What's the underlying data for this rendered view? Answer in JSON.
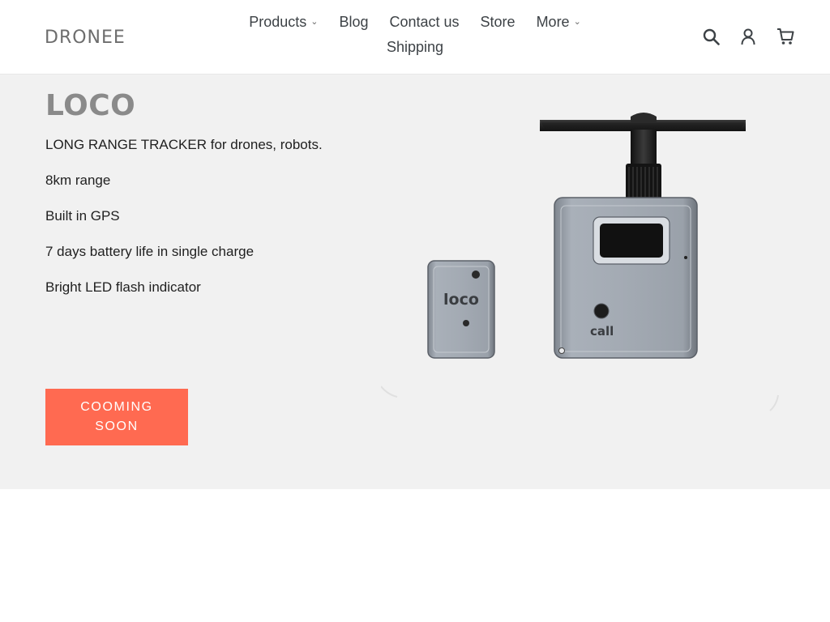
{
  "header": {
    "logo": "DRONEE",
    "nav": [
      {
        "label": "Products",
        "dropdown": true
      },
      {
        "label": "Blog",
        "dropdown": false
      },
      {
        "label": "Contact us",
        "dropdown": false
      },
      {
        "label": "Store",
        "dropdown": false
      },
      {
        "label": "More",
        "dropdown": true
      },
      {
        "label": "Shipping",
        "dropdown": false
      }
    ],
    "icons": [
      "search-icon",
      "account-icon",
      "cart-icon"
    ]
  },
  "hero": {
    "title": "LOCO",
    "features": [
      "LONG RANGE TRACKER for drones, robots.",
      "8km range",
      "Built in GPS",
      "7 days battery life in single charge",
      "Bright LED flash indicator"
    ],
    "cta_label": "COOMING SOON",
    "image": {
      "tag_label": "loco",
      "unit_label": "call"
    }
  },
  "colors": {
    "accent": "#ff6a51",
    "hero_background": "#f1f1f1",
    "title": "#8a8a8a"
  }
}
